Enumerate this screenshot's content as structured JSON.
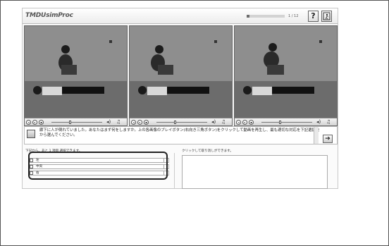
{
  "header": {
    "logo_text": "TMDUsimProc",
    "progress_fraction": 0.083,
    "page_count": "1 / 12",
    "help_label": "?",
    "exit_icon": "exit-figure-icon"
  },
  "videos": [
    {
      "id": "A",
      "scene": "cpr-check-1"
    },
    {
      "id": "B",
      "scene": "cpr-check-2"
    },
    {
      "id": "C",
      "scene": "cpr-check-3"
    }
  ],
  "player": {
    "controls": [
      "rewind-icon",
      "play-icon",
      "stop-icon"
    ],
    "volume_icon": "volume-icon",
    "note_icon": "music-note-icon"
  },
  "question": {
    "text": "廊下に人が倒れていました。あなたはまず何をしますか。上の各画像のプレイボタン(右向き三角ボタン)をクリックして動画を再生し、最も適切な対応を下記選択肢から選んでください。",
    "next_label": "➔"
  },
  "answers": {
    "instruction": "下記から、あと   1   項目 選択できます。",
    "right_instruction": "クリックして取り消しができます。",
    "options": [
      "左",
      "中央",
      "右"
    ]
  },
  "colors": {
    "accent": "#222222",
    "border": "#aaaaaa"
  }
}
